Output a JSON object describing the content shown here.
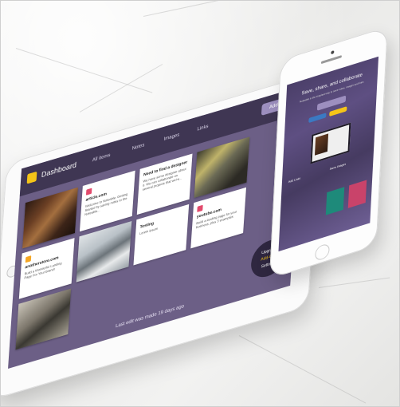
{
  "tablet": {
    "app": {
      "title": "Dashboard",
      "nav": [
        "All items",
        "Notes",
        "Images",
        "Links"
      ],
      "add_button": "Add New",
      "cards": [
        {
          "title": "article.com",
          "text": "Welcome to Noteable. Getting Started by saving notes to the Noteable..."
        },
        {
          "title": "Need to find a designer",
          "text": "We have some designer about it. We can collaborate on several projects that we're..."
        },
        {
          "title": "anotherstore.com",
          "text": "Build a Wonderful Landing Page For Your Brand!"
        },
        {
          "title": "Testing",
          "text": "Lorem ipsum"
        },
        {
          "title": "youtube.com",
          "text": "Build a landing page for your business, plus 3 examples"
        }
      ],
      "footer": "Last edit was made 19 days ago",
      "upgrade": {
        "line1": "Upgrade",
        "line2": "Add-Ons",
        "line3": "Settings"
      }
    }
  },
  "phone": {
    "headline": "Save, share, and collaborate",
    "subtext": "Noteable is the simplest way to save notes, images and links",
    "labels": [
      "Add Links",
      "Save Images"
    ]
  },
  "colors": {
    "nav": "#3f3653",
    "screen": "#6c5f86",
    "accent": "#9d8fbf",
    "logo": "#f5c518"
  }
}
